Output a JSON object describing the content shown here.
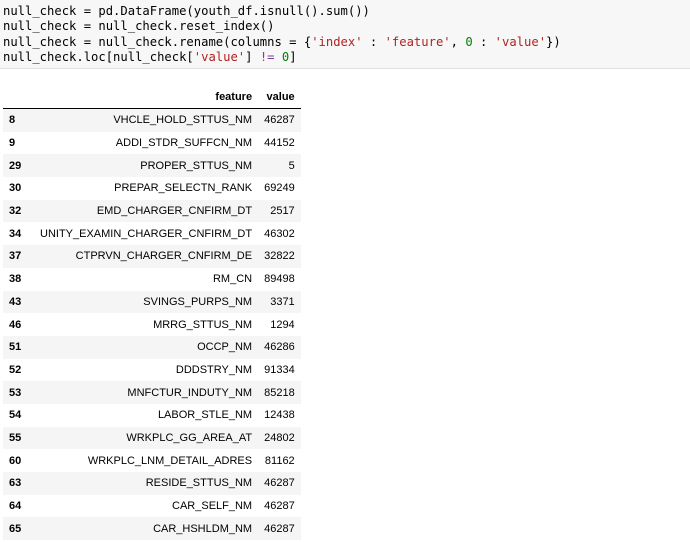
{
  "code": {
    "line1": "null_check = pd.DataFrame(youth_df.isnull().sum())",
    "line2": "null_check = null_check.reset_index()",
    "line3_pre": "null_check = null_check.rename(columns = {",
    "line3_s1": "'index'",
    "line3_mid1": " : ",
    "line3_s2": "'feature'",
    "line3_mid2": ", ",
    "line3_num": "0",
    "line3_mid3": " : ",
    "line3_s3": "'value'",
    "line3_post": "})",
    "line4_pre": "null_check.loc[null_check[",
    "line4_s1": "'value'",
    "line4_mid": "] ",
    "line4_op": "!=",
    "line4_sp": " ",
    "line4_num": "0",
    "line4_post": "]"
  },
  "table": {
    "index_header": "",
    "columns": [
      "feature",
      "value"
    ],
    "rows": [
      {
        "index": "8",
        "feature": "VHCLE_HOLD_STTUS_NM",
        "value": "46287"
      },
      {
        "index": "9",
        "feature": "ADDI_STDR_SUFFCN_NM",
        "value": "44152"
      },
      {
        "index": "29",
        "feature": "PROPER_STTUS_NM",
        "value": "5"
      },
      {
        "index": "30",
        "feature": "PREPAR_SELECTN_RANK",
        "value": "69249"
      },
      {
        "index": "32",
        "feature": "EMD_CHARGER_CNFIRM_DT",
        "value": "2517"
      },
      {
        "index": "34",
        "feature": "UNITY_EXAMIN_CHARGER_CNFIRM_DT",
        "value": "46302"
      },
      {
        "index": "37",
        "feature": "CTPRVN_CHARGER_CNFIRM_DE",
        "value": "32822"
      },
      {
        "index": "38",
        "feature": "RM_CN",
        "value": "89498"
      },
      {
        "index": "43",
        "feature": "SVINGS_PURPS_NM",
        "value": "3371"
      },
      {
        "index": "46",
        "feature": "MRRG_STTUS_NM",
        "value": "1294"
      },
      {
        "index": "51",
        "feature": "OCCP_NM",
        "value": "46286"
      },
      {
        "index": "52",
        "feature": "DDDSTRY_NM",
        "value": "91334"
      },
      {
        "index": "53",
        "feature": "MNFCTUR_INDUTY_NM",
        "value": "85218"
      },
      {
        "index": "54",
        "feature": "LABOR_STLE_NM",
        "value": "12438"
      },
      {
        "index": "55",
        "feature": "WRKPLC_GG_AREA_AT",
        "value": "24802"
      },
      {
        "index": "60",
        "feature": "WRKPLC_LNM_DETAIL_ADRES",
        "value": "81162"
      },
      {
        "index": "63",
        "feature": "RESIDE_STTUS_NM",
        "value": "46287"
      },
      {
        "index": "64",
        "feature": "CAR_SELF_NM",
        "value": "46287"
      },
      {
        "index": "65",
        "feature": "CAR_HSHLDM_NM",
        "value": "46287"
      }
    ]
  },
  "colors": {
    "code_bg": "#f7f7f7",
    "operator": "#7a3e9d",
    "string": "#b22222",
    "number": "#008000",
    "row_stripe": "#f5f5f5"
  }
}
